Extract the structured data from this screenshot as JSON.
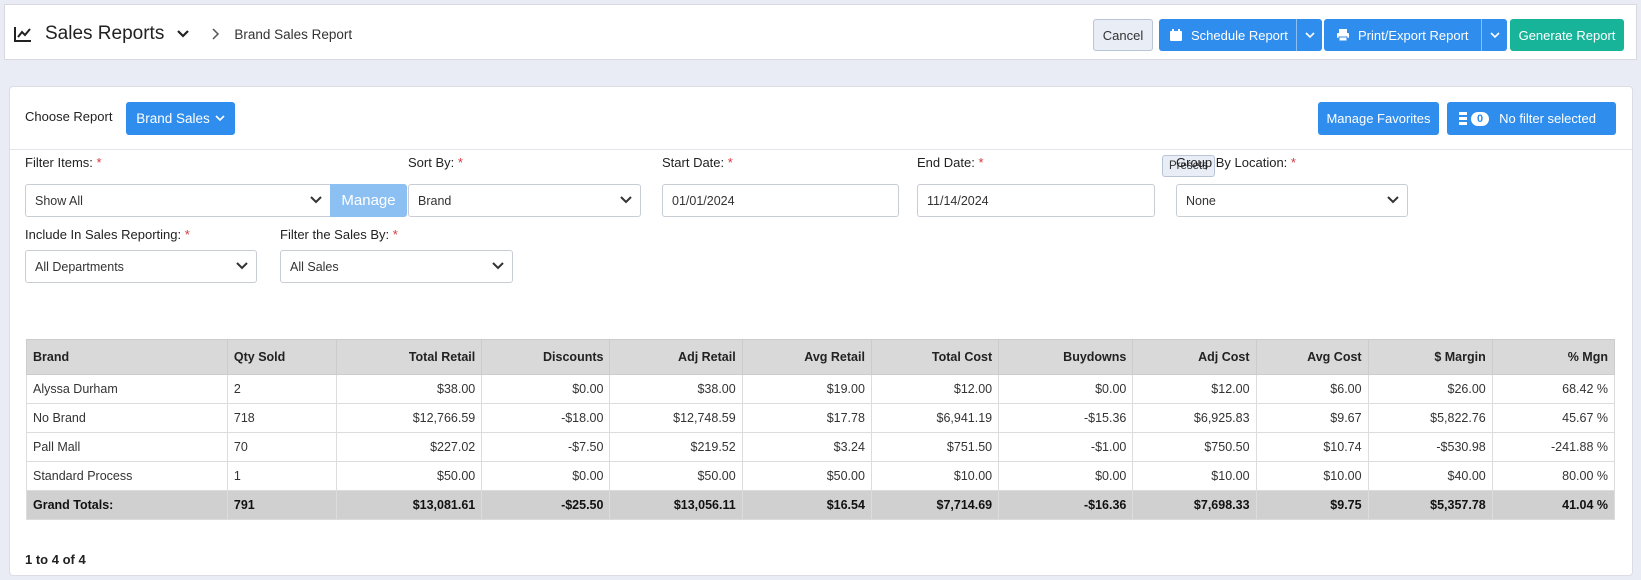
{
  "header": {
    "title": "Sales Reports",
    "breadcrumb": "Brand Sales Report",
    "buttons": {
      "cancel": "Cancel",
      "schedule": "Schedule Report",
      "print": "Print/Export Report",
      "generate": "Generate Report"
    }
  },
  "toolbar": {
    "choose_label": "Choose Report",
    "report_button": "Brand Sales",
    "favorites_button": "Manage Favorites",
    "filter_count": "0",
    "filter_label": "No filter selected"
  },
  "filters": {
    "filter_items": {
      "label": "Filter Items:",
      "value": "Show All",
      "manage": "Manage"
    },
    "sort_by": {
      "label": "Sort By:",
      "value": "Brand"
    },
    "start_date": {
      "label": "Start Date:",
      "value": "01/01/2024"
    },
    "end_date": {
      "label": "End Date:",
      "value": "11/14/2024",
      "presets": "Presets"
    },
    "group_by": {
      "label": "Group By Location:",
      "value": "None"
    },
    "include": {
      "label": "Include In Sales Reporting:",
      "value": "All Departments"
    },
    "sales_by": {
      "label": "Filter the Sales By:",
      "value": "All Sales"
    },
    "required_mark": "*"
  },
  "table": {
    "columns": [
      "Brand",
      "Qty Sold",
      "Total Retail",
      "Discounts",
      "Adj Retail",
      "Avg Retail",
      "Total Cost",
      "Buydowns",
      "Adj Cost",
      "Avg Cost",
      "$ Margin",
      "% Mgn"
    ],
    "rows": [
      [
        "Alyssa Durham",
        "2",
        "$38.00",
        "$0.00",
        "$38.00",
        "$19.00",
        "$12.00",
        "$0.00",
        "$12.00",
        "$6.00",
        "$26.00",
        "68.42 %"
      ],
      [
        "No Brand",
        "718",
        "$12,766.59",
        "-$18.00",
        "$12,748.59",
        "$17.78",
        "$6,941.19",
        "-$15.36",
        "$6,925.83",
        "$9.67",
        "$5,822.76",
        "45.67 %"
      ],
      [
        "Pall Mall",
        "70",
        "$227.02",
        "-$7.50",
        "$219.52",
        "$3.24",
        "$751.50",
        "-$1.00",
        "$750.50",
        "$10.74",
        "-$530.98",
        "-241.88 %"
      ],
      [
        "Standard Process",
        "1",
        "$50.00",
        "$0.00",
        "$50.00",
        "$50.00",
        "$10.00",
        "$0.00",
        "$10.00",
        "$10.00",
        "$40.00",
        "80.00 %"
      ]
    ],
    "totals": [
      "Grand Totals:",
      "791",
      "$13,081.61",
      "-$25.50",
      "$13,056.11",
      "$16.54",
      "$7,714.69",
      "-$16.36",
      "$7,698.33",
      "$9.75",
      "$5,357.78",
      "41.04 %"
    ]
  },
  "pager": "1 to 4 of 4",
  "colors": {
    "primary": "#2f8ded",
    "success": "#17b49a",
    "manage": "#8cc0f3",
    "required": "#d9363e"
  }
}
